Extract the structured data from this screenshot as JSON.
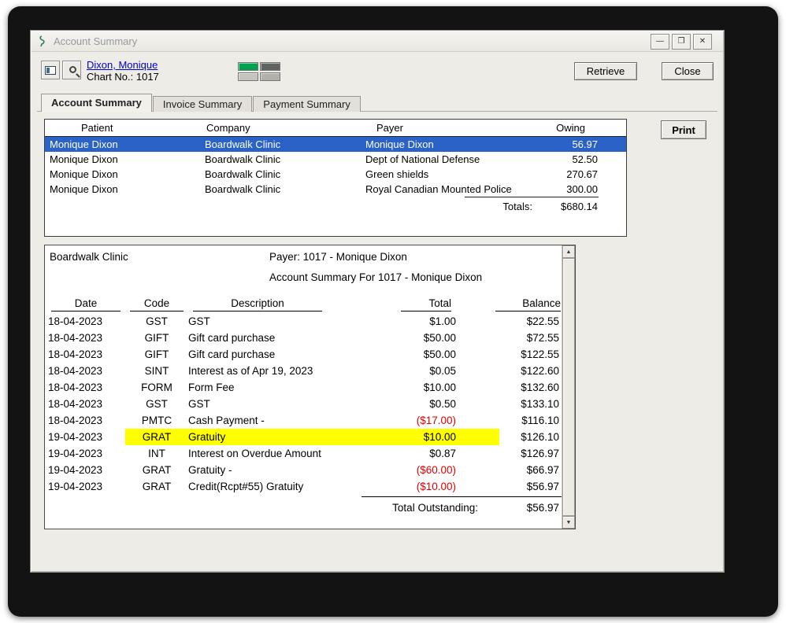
{
  "colors": {
    "selected_row_bg": "#2a62c8",
    "selected_row_text": "#ffffff",
    "highlight_bg": "#ffff00",
    "negative_text": "#e10000",
    "link_text": "#0000cc",
    "status_green": "#00a24f"
  },
  "icons": {
    "minimize": "—",
    "maximize": "❐",
    "close": "✕",
    "scroll_up": "▲",
    "scroll_down": "▼"
  },
  "window": {
    "title": "Account Summary"
  },
  "header": {
    "patient_link": "Dixon, Monique",
    "chart_label": "Chart No.: 1017",
    "retrieve_button": "Retrieve",
    "close_button": "Close"
  },
  "tabs": [
    {
      "label": "Account Summary",
      "active": true
    },
    {
      "label": "Invoice Summary",
      "active": false
    },
    {
      "label": "Payment Summary",
      "active": false
    }
  ],
  "payer_table": {
    "columns": [
      "Patient",
      "Company",
      "Payer",
      "Owing"
    ],
    "rows": [
      {
        "patient": "Monique Dixon",
        "company": "Boardwalk Clinic",
        "payer": "Monique Dixon",
        "owing": "56.97",
        "selected": true
      },
      {
        "patient": "Monique Dixon",
        "company": "Boardwalk Clinic",
        "payer": "Dept of National Defense",
        "owing": "52.50",
        "selected": false
      },
      {
        "patient": "Monique Dixon",
        "company": "Boardwalk Clinic",
        "payer": "Green shields",
        "owing": "270.67",
        "selected": false
      },
      {
        "patient": "Monique Dixon",
        "company": "Boardwalk Clinic",
        "payer": "Royal Canadian Mounted Police",
        "owing": "300.00",
        "selected": false
      }
    ],
    "totals_label": "Totals:",
    "totals_value": "$680.14"
  },
  "print_button": "Print",
  "statement": {
    "clinic_name": "Boardwalk Clinic",
    "payer_line": "Payer: 1017 - Monique Dixon",
    "title_line": "Account Summary For 1017 - Monique Dixon",
    "columns": [
      "Date",
      "Code",
      "Description",
      "Total",
      "Balance"
    ],
    "rows": [
      {
        "date": "18-04-2023",
        "code": "GST",
        "description": "GST",
        "total": "$1.00",
        "balance": "$22.55",
        "negative": false,
        "highlighted": false
      },
      {
        "date": "18-04-2023",
        "code": "GIFT",
        "description": "Gift card purchase",
        "total": "$50.00",
        "balance": "$72.55",
        "negative": false,
        "highlighted": false
      },
      {
        "date": "18-04-2023",
        "code": "GIFT",
        "description": "Gift card purchase",
        "total": "$50.00",
        "balance": "$122.55",
        "negative": false,
        "highlighted": false
      },
      {
        "date": "18-04-2023",
        "code": "SINT",
        "description": "Interest as of Apr 19, 2023",
        "total": "$0.05",
        "balance": "$122.60",
        "negative": false,
        "highlighted": false
      },
      {
        "date": "18-04-2023",
        "code": "FORM",
        "description": "Form Fee",
        "total": "$10.00",
        "balance": "$132.60",
        "negative": false,
        "highlighted": false
      },
      {
        "date": "18-04-2023",
        "code": "GST",
        "description": "GST",
        "total": "$0.50",
        "balance": "$133.10",
        "negative": false,
        "highlighted": false
      },
      {
        "date": "18-04-2023",
        "code": "PMTC",
        "description": "Cash Payment -",
        "total": "($17.00)",
        "balance": "$116.10",
        "negative": true,
        "highlighted": false
      },
      {
        "date": "19-04-2023",
        "code": "GRAT",
        "description": "Gratuity",
        "total": "$10.00",
        "balance": "$126.10",
        "negative": false,
        "highlighted": true
      },
      {
        "date": "19-04-2023",
        "code": "INT",
        "description": "Interest on Overdue Amount",
        "total": "$0.87",
        "balance": "$126.97",
        "negative": false,
        "highlighted": false
      },
      {
        "date": "19-04-2023",
        "code": "GRAT",
        "description": "Gratuity -",
        "total": "($60.00)",
        "balance": "$66.97",
        "negative": true,
        "highlighted": false
      },
      {
        "date": "19-04-2023",
        "code": "GRAT",
        "description": "Credit(Rcpt#55) Gratuity",
        "total": "($10.00)",
        "balance": "$56.97",
        "negative": true,
        "highlighted": false
      }
    ],
    "total_outstanding_label": "Total Outstanding:",
    "total_outstanding_value": "$56.97"
  }
}
